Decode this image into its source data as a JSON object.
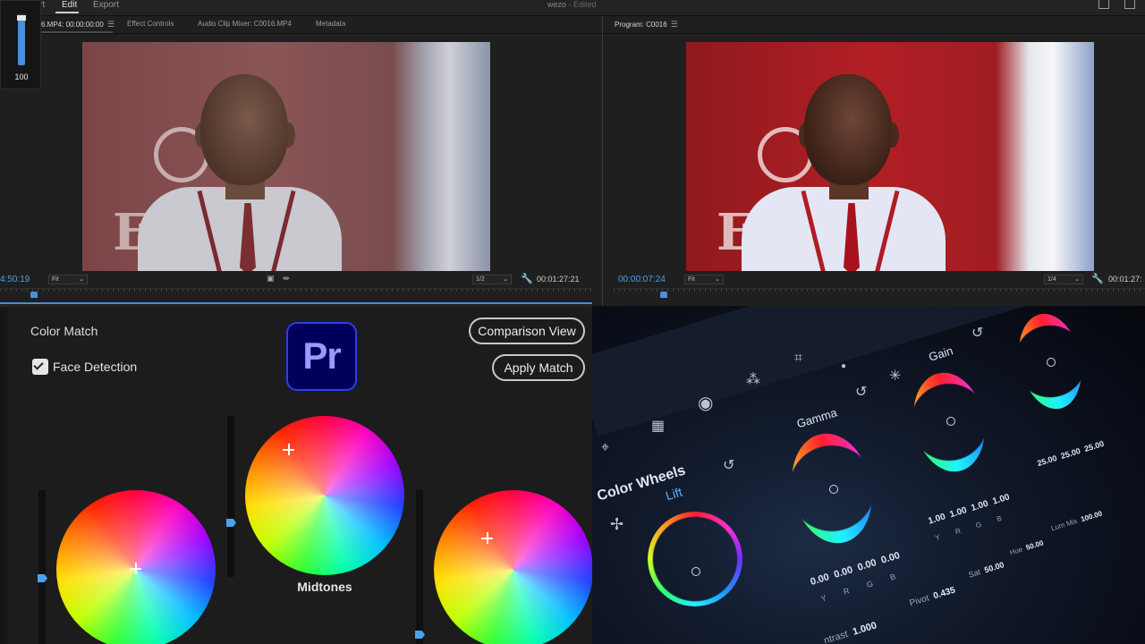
{
  "topbar": {
    "menu": [
      {
        "label": "Import"
      },
      {
        "label": "Edit"
      },
      {
        "label": "Export"
      }
    ],
    "project_title": "wezo",
    "project_status": "- Edited"
  },
  "volume": {
    "value": "100",
    "level": 1.0
  },
  "source": {
    "tabs": [
      {
        "label": "6.MP4: 00:00:00:00"
      },
      {
        "label": "Effect Controls"
      },
      {
        "label": "Audio Clip Mixer: C0016.MP4"
      },
      {
        "label": "Metadata"
      }
    ],
    "timecode_current": "4:50:19",
    "fit": "Fit",
    "resolution": "1/2",
    "timecode_duration": "00:01:27:21",
    "frame_letters": "EE"
  },
  "program": {
    "tab": "Program: C0016",
    "timecode_current": "00:00:07:24",
    "fit": "Fit",
    "resolution": "1/4",
    "timecode_duration": "00:01:27:",
    "frame_letters": "EE"
  },
  "color_match": {
    "title": "Color Match",
    "face_detection_label": "Face Detection",
    "face_detection_checked": true,
    "app_badge": "Pr",
    "comparison_view": "Comparison View",
    "apply_match": "Apply Match",
    "midtones_label": "Midtones"
  },
  "resolve": {
    "panel_title": "Color Wheels",
    "lift": "Lift",
    "gamma": "Gamma",
    "gain": "Gain",
    "lift_values": [
      "0.00",
      "0.00",
      "0.00",
      "0.00"
    ],
    "lift_channels": [
      "Y",
      "R",
      "G",
      "B"
    ],
    "gamma_values": [
      "1.00",
      "1.00",
      "1.00",
      "1.00"
    ],
    "gamma_channels": [
      "Y",
      "R",
      "G",
      "B"
    ],
    "gain_values": [
      "25.00",
      "25.00",
      "25.00"
    ],
    "contrast_label": "ntrast",
    "contrast_value": "1.000",
    "pivot_label": "Pivot",
    "pivot_value": "0.435",
    "sat_label": "Sat",
    "sat_value": "50.00",
    "hue_label": "Hue",
    "hue_value": "50.00",
    "lum_label": "Lum Mix",
    "lum_value": "100.00"
  },
  "colors": {
    "accent_blue": "#4a8fd8",
    "premiere_bg": "#00005b",
    "premiere_text": "#9999ff"
  }
}
